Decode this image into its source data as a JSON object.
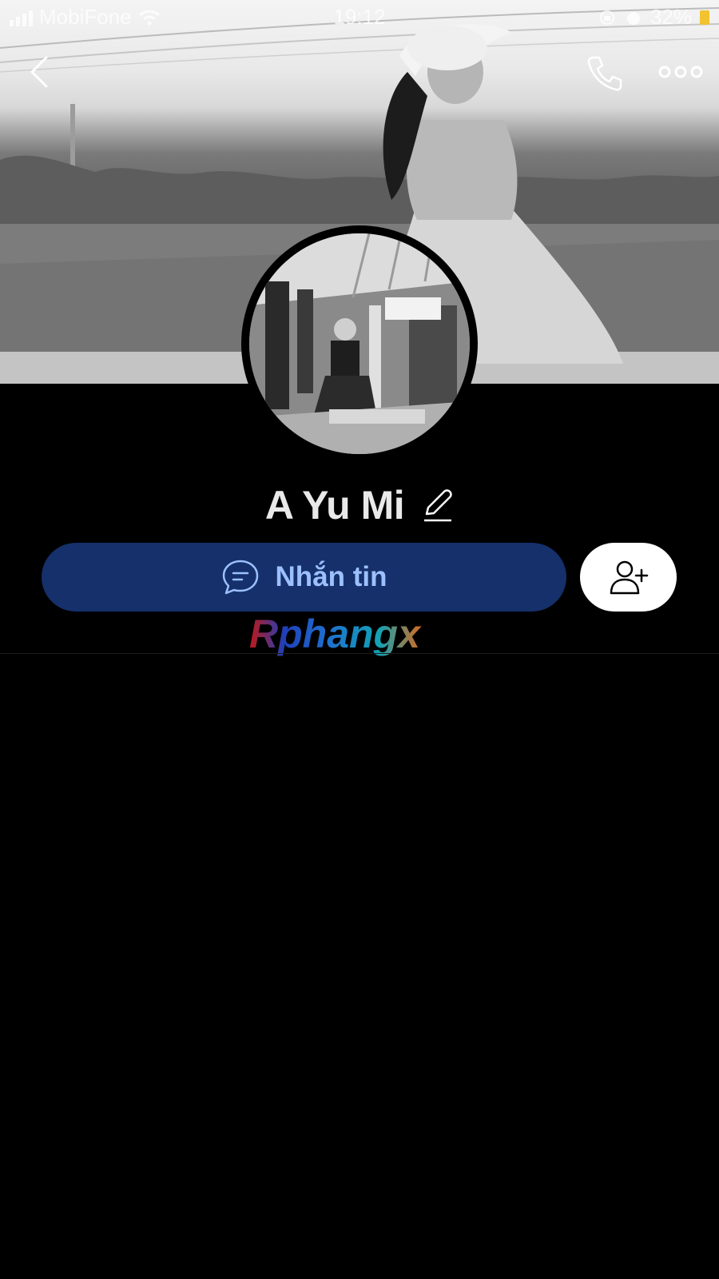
{
  "status_bar": {
    "carrier": "MobiFone",
    "time": "19:12",
    "battery": "32%"
  },
  "nav": {
    "back_icon": "chevron-left-icon",
    "call_icon": "phone-icon",
    "more_icon": "more-horizontal-icon"
  },
  "profile": {
    "name": "A Yu Mi",
    "edit_icon": "pencil-icon"
  },
  "actions": {
    "message_label": "Nhắn tin",
    "message_icon": "chat-bubble-icon",
    "add_friend_icon": "add-user-icon"
  },
  "watermark": {
    "text": "Rphangx"
  },
  "colors": {
    "background": "#000000",
    "message_button": "#15306a",
    "message_label": "#9cc0ff",
    "add_button": "#ffffff",
    "battery": "#f2c230"
  }
}
